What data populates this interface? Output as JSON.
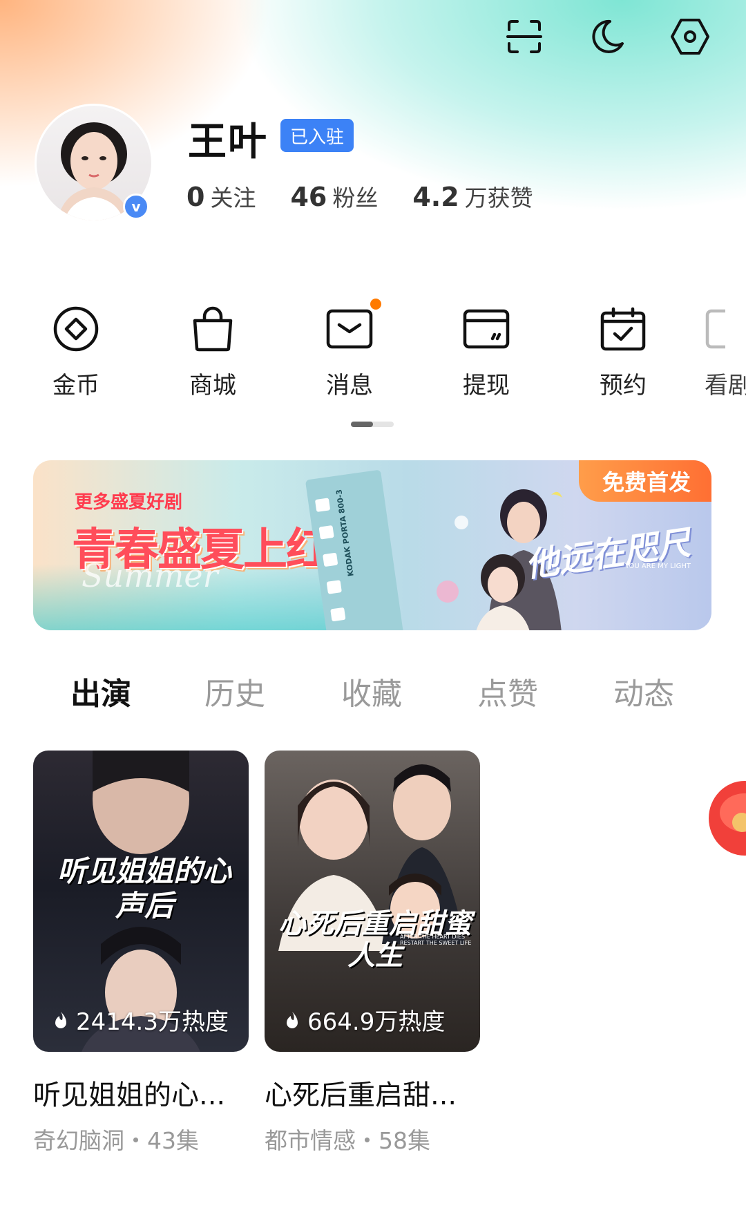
{
  "header": {
    "icons": [
      "scan-icon",
      "moon-icon",
      "settings-icon"
    ]
  },
  "profile": {
    "username": "王叶",
    "badge": "已入驻",
    "verified_mark": "v",
    "stats": [
      {
        "num": "0",
        "label": "关注"
      },
      {
        "num": "46",
        "label": "粉丝"
      },
      {
        "num": "4.2",
        "label": "万获赞"
      }
    ]
  },
  "quick_actions": [
    {
      "label": "金币",
      "icon": "coin-icon"
    },
    {
      "label": "商城",
      "icon": "shopping-bag-icon"
    },
    {
      "label": "消息",
      "icon": "message-icon"
    },
    {
      "label": "提现",
      "icon": "wallet-icon"
    },
    {
      "label": "预约",
      "icon": "calendar-check-icon"
    },
    {
      "label": "看剧",
      "icon": "watch-icon"
    }
  ],
  "banner": {
    "subtitle": "更多盛夏好剧",
    "title": "青春盛夏上红果",
    "script_word": "Summer",
    "film_text": "KODAK PORTA 800-3",
    "corner_badge": "免费首发",
    "drama_title": "他远在咫尺",
    "drama_subtitle": "YOU ARE MY LIGHT"
  },
  "tabs": [
    {
      "label": "出演",
      "active": true
    },
    {
      "label": "历史",
      "active": false
    },
    {
      "label": "收藏",
      "active": false
    },
    {
      "label": "点赞",
      "active": false
    },
    {
      "label": "动态",
      "active": false
    }
  ],
  "cards": [
    {
      "poster_text": "听见姐姐的心声后",
      "heat": "2414.3万热度",
      "title": "听见姐姐的心...",
      "meta": "奇幻脑洞・43集"
    },
    {
      "poster_text": "心死后重启甜蜜人生",
      "poster_sub": "AFTER THE HEART DIES RESTART THE SWEET LIFE",
      "heat": "664.9万热度",
      "title": "心死后重启甜...",
      "meta": "都市情感・58集"
    }
  ],
  "colors": {
    "accent_blue": "#3c82f6",
    "notification_dot": "#ff7a00",
    "banner_badge": "#ff6f33"
  }
}
